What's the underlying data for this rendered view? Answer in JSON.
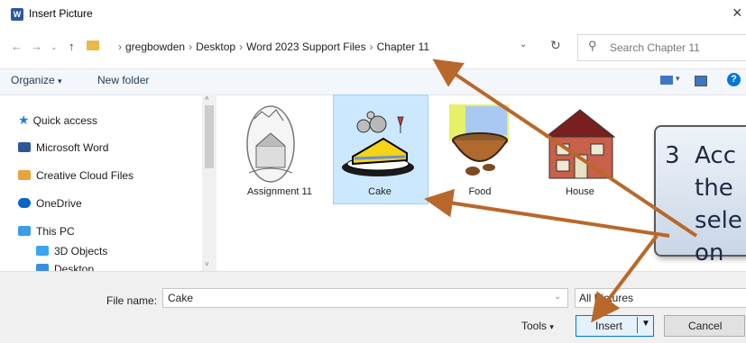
{
  "window": {
    "title": "Insert Picture",
    "app_icon_letter": "W",
    "close_glyph": "×"
  },
  "address": {
    "crumbs": [
      "gregbowden",
      "Desktop",
      "Word 2023 Support Files",
      "Chapter 11"
    ],
    "search_placeholder": "Search Chapter 11"
  },
  "toolbar": {
    "organize": "Organize",
    "new_folder": "New folder"
  },
  "sidebar": {
    "items": [
      {
        "label": "Quick access",
        "icon": "star-icon",
        "color": "#1e7fd6"
      },
      {
        "label": "Microsoft Word",
        "icon": "word-icon",
        "color": "#2b579a"
      },
      {
        "label": "Creative Cloud Files",
        "icon": "cloud-folder-icon",
        "color": "#e8a33d"
      },
      {
        "label": "OneDrive",
        "icon": "onedrive-icon",
        "color": "#0a64c8"
      },
      {
        "label": "This PC",
        "icon": "pc-icon",
        "color": "#3d9be9"
      },
      {
        "label": "3D Objects",
        "icon": "cube-icon",
        "color": "#3aa6f0"
      },
      {
        "label": "Desktop",
        "icon": "desktop-icon",
        "color": "#3d8ee0"
      }
    ]
  },
  "files": [
    {
      "name": "Assignment 11",
      "selected": false
    },
    {
      "name": "Cake",
      "selected": true
    },
    {
      "name": "Food",
      "selected": false
    },
    {
      "name": "House",
      "selected": false
    }
  ],
  "footer": {
    "file_name_label": "File name:",
    "file_name_value": "Cake",
    "filter_value": "All Pictures",
    "tools_label": "Tools",
    "insert_label": "Insert",
    "cancel_label": "Cancel"
  },
  "callout": {
    "text": "3  Acc\n    the\n    sele\n    on "
  },
  "colors": {
    "accent": "#0078d7",
    "arrow": "#b8682a",
    "selection": "#cce8ff"
  }
}
